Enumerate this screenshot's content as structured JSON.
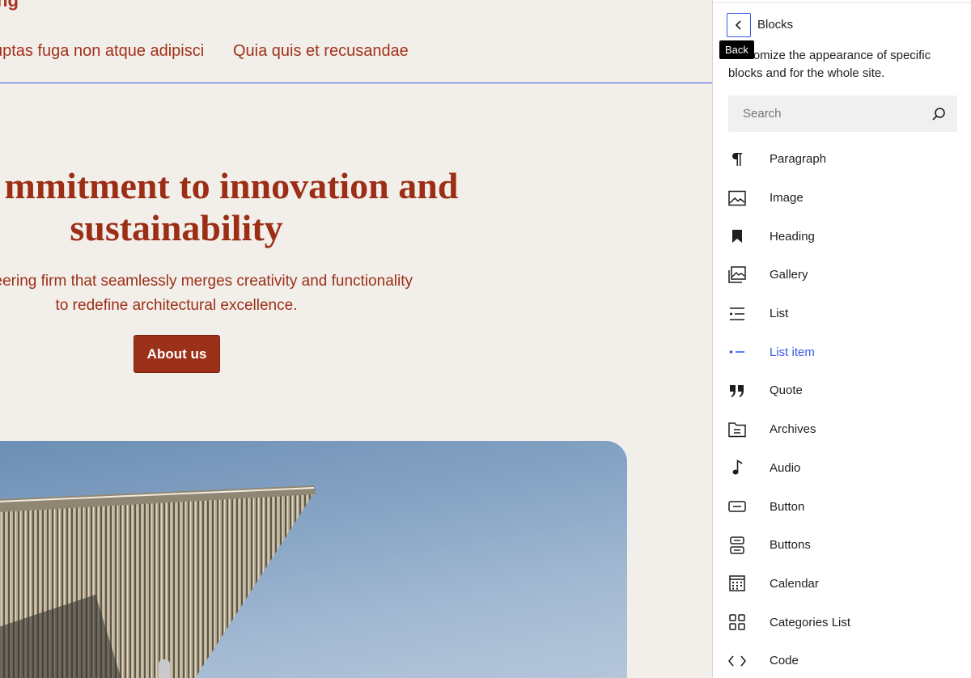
{
  "canvas": {
    "site_title": "ng",
    "nav": [
      "uptas fuga non atque adipisci",
      "Quia quis et recusandae"
    ],
    "hero_title": "Our commitment to innovation and sustainability",
    "hero_title_visible": "mmitment to innovation and sustainability",
    "hero_text": "s a pioneering firm that seamlessly merges creativity and functionality to redefine architectural excellence.",
    "about_button": "About us"
  },
  "sidebar": {
    "back_tooltip": "Back",
    "title": "Blocks",
    "description": "Customize the appearance of specific blocks and for the whole site.",
    "search_placeholder": "Search",
    "blocks": [
      {
        "label": "Paragraph",
        "icon": "paragraph-icon"
      },
      {
        "label": "Image",
        "icon": "image-icon"
      },
      {
        "label": "Heading",
        "icon": "heading-icon"
      },
      {
        "label": "Gallery",
        "icon": "gallery-icon"
      },
      {
        "label": "List",
        "icon": "list-icon"
      },
      {
        "label": "List item",
        "icon": "list-item-icon",
        "active": true
      },
      {
        "label": "Quote",
        "icon": "quote-icon"
      },
      {
        "label": "Archives",
        "icon": "archives-icon"
      },
      {
        "label": "Audio",
        "icon": "audio-icon"
      },
      {
        "label": "Button",
        "icon": "button-icon"
      },
      {
        "label": "Buttons",
        "icon": "buttons-icon"
      },
      {
        "label": "Calendar",
        "icon": "calendar-icon"
      },
      {
        "label": "Categories List",
        "icon": "categories-list-icon"
      },
      {
        "label": "Code",
        "icon": "code-icon"
      }
    ]
  },
  "colors": {
    "accent": "#3858e9",
    "brand_red": "#9b3118",
    "canvas_bg": "#f2efea"
  }
}
